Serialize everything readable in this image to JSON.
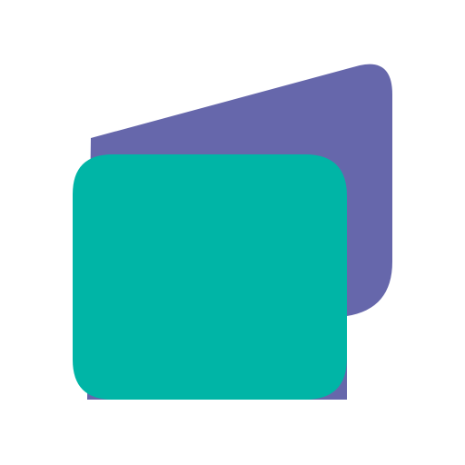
{
  "logo": {
    "name": "stacked-folder-logo",
    "colors": {
      "background": "#ffffff",
      "back_panel": "#6667AB",
      "front_panel": "#00B5A6"
    }
  }
}
